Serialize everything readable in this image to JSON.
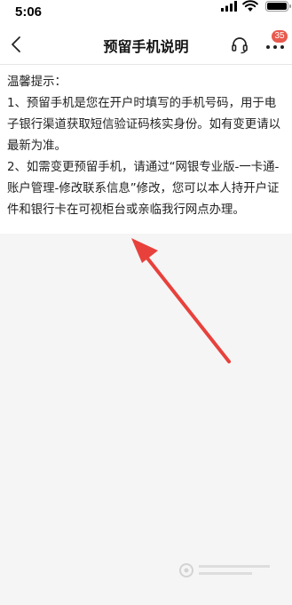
{
  "status_bar": {
    "time": "5:06"
  },
  "nav": {
    "title": "预留手机说明",
    "badge_count": "35"
  },
  "content": {
    "tip_heading": "温馨提示：",
    "paragraph_1": "1、预留手机是您在开户时填写的手机号码，用于电子银行渠道获取短信验证码核实身份。如有变更请以最新为准。",
    "paragraph_2": "2、如需变更预留手机，请通过“网银专业版-一卡通-账户管理-修改联系信息”修改，您可以本人持开户证件和银行卡在可视柜台或亲临我行网点办理。"
  },
  "icons": {
    "back": "chevron-left-icon",
    "headset": "headset-icon",
    "more": "more-icon"
  },
  "colors": {
    "badge": "#e85a4f",
    "annotation_arrow": "#e8413c",
    "page_background": "#f5f5f5"
  }
}
